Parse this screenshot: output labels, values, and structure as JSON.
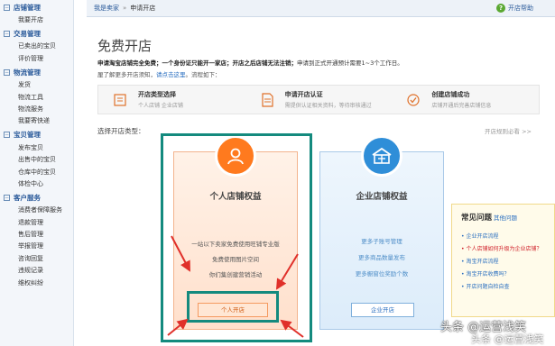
{
  "sidebar": {
    "sections": [
      {
        "title": "店铺管理",
        "items": [
          "我要开店"
        ]
      },
      {
        "title": "交易管理",
        "items": [
          "已卖出的宝贝",
          "评价管理"
        ]
      },
      {
        "title": "物流管理",
        "items": [
          "发货",
          "物流工具",
          "物流服务",
          "我要寄快递"
        ]
      },
      {
        "title": "宝贝管理",
        "items": [
          "发布宝贝",
          "出售中的宝贝",
          "仓库中的宝贝",
          "体检中心"
        ]
      },
      {
        "title": "客户服务",
        "items": [
          "消费者保障服务",
          "退款管理",
          "售后管理",
          "举报管理",
          "咨询回复",
          "违规记录",
          "维权纠纷"
        ]
      }
    ]
  },
  "breadcrumb": {
    "root": "我是卖家",
    "sep": "»",
    "current": "申请开店"
  },
  "help_label": "开店帮助",
  "main": {
    "title": "免费开店",
    "intro_bold": "申请淘宝店铺完全免费；一个身份证只能开一家店；开店之后店铺无法注销；",
    "intro_rest": "申请到正式开通预计需要1~3个工作日。",
    "intro2_prefix": "厘了解更多开店须知，",
    "intro2_link": "请点击这里",
    "intro2_suffix": "。流程如下："
  },
  "steps": [
    {
      "title": "开店类型选择",
      "sub": "个人店铺  企业店铺",
      "icon": "store-type-icon"
    },
    {
      "title": "申请开店认证",
      "sub": "需提供认证相关资料，等待审核通过",
      "icon": "document-icon"
    },
    {
      "title": "创建店铺成功",
      "sub": "店铺开通后完善店铺信息",
      "icon": "check-circle-icon"
    }
  ],
  "choose_label": "选择开店类型：",
  "rules_link": "开店规则必看 >>",
  "personal": {
    "title": "个人店铺权益",
    "features": [
      "一站以下卖家免费使用旺铺专业版",
      "免费使用图片空间",
      "你们集创建营销活动"
    ],
    "button": "个人开店"
  },
  "corp": {
    "title": "企业店铺权益",
    "features": [
      "更多子账号管理",
      "更多商品数量发布",
      "更多橱窗位奖励个数"
    ],
    "button": "企业开店"
  },
  "faq": {
    "title": "常见问题",
    "more": "其他问题",
    "items": [
      {
        "text": "企业开店流程",
        "highlight": false
      },
      {
        "text": "个人店铺如何升级为企业店铺？",
        "highlight": true
      },
      {
        "text": "淘宝开店流程",
        "highlight": false
      },
      {
        "text": "淘宝开店收费吗？",
        "highlight": false
      },
      {
        "text": "开店问题自检自查",
        "highlight": false
      }
    ]
  },
  "watermark": {
    "line1": "头条 @运营浅笑",
    "line2": "头条 @运营浅笑"
  },
  "colors": {
    "accent_teal": "#148a7e",
    "arrow_red": "#e0302a",
    "personal_orange": "#ff7a1e",
    "corp_blue": "#2f8ed8"
  }
}
